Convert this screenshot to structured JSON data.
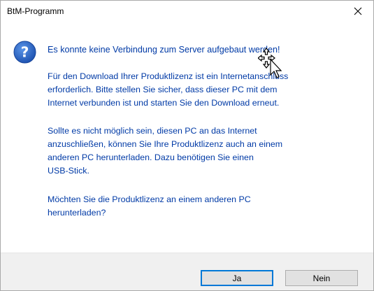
{
  "window": {
    "title": "BtM-Programm",
    "close_glyph": "✕"
  },
  "icons": {
    "message_icon": "question-icon",
    "close_icon": "close-icon",
    "cursor": "move-cursor-icon"
  },
  "colors": {
    "message_text": "#003aa6",
    "icon_blue": "#1f5fbf",
    "footer_bg": "#f0f0f0",
    "button_bg": "#e1e1e1",
    "focus_border": "#0078d7"
  },
  "message": {
    "headline": "Es konnte keine Verbindung zum Server aufgebaut werden!",
    "paragraph1": [
      "Für den Download Ihrer Produktlizenz ist ein Internetanschluss",
      "erforderlich. Bitte stellen Sie sicher, dass dieser PC mit dem",
      "Internet verbunden ist und starten Sie den Download erneut."
    ],
    "paragraph2": [
      "Sollte es nicht möglich sein, diesen PC an das Internet",
      "anzuschließen, können Sie Ihre Produktlizenz auch an einem",
      "anderen PC herunterladen. Dazu benötigen Sie einen",
      "USB-Stick."
    ],
    "paragraph3": [
      "Möchten Sie die Produktlizenz an einem anderen PC",
      "herunterladen?"
    ]
  },
  "buttons": {
    "yes_label": "Ja",
    "no_label": "Nein"
  }
}
